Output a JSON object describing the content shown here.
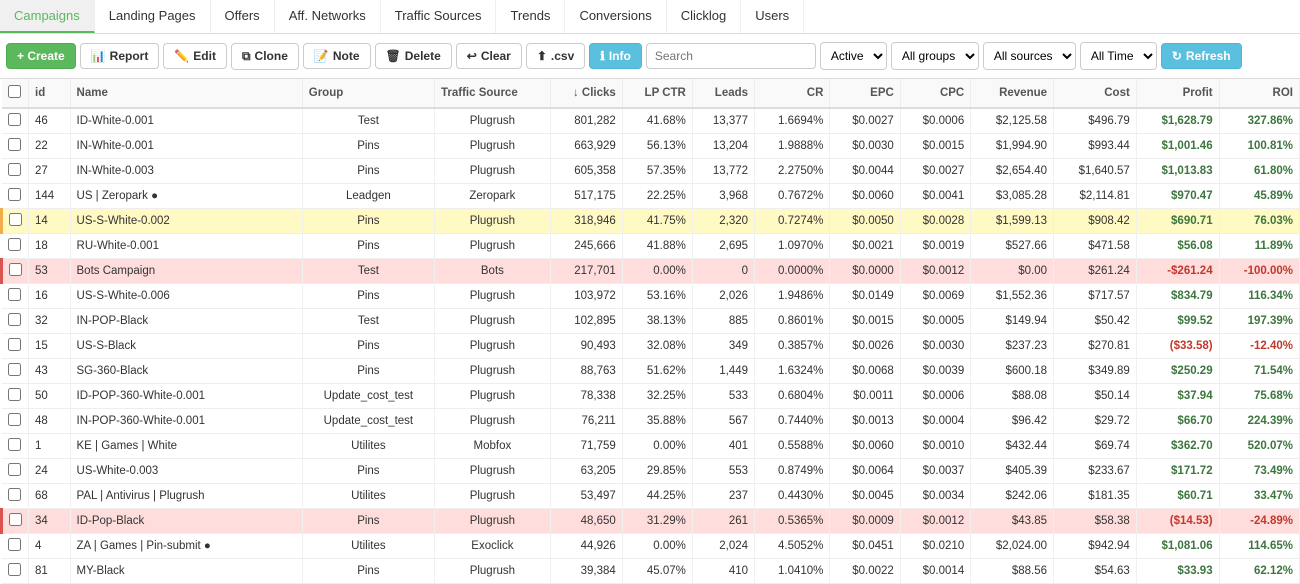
{
  "nav": {
    "items": [
      {
        "label": "Campaigns",
        "active": true
      },
      {
        "label": "Landing Pages",
        "active": false
      },
      {
        "label": "Offers",
        "active": false
      },
      {
        "label": "Aff. Networks",
        "active": false
      },
      {
        "label": "Traffic Sources",
        "active": false
      },
      {
        "label": "Trends",
        "active": false
      },
      {
        "label": "Conversions",
        "active": false
      },
      {
        "label": "Clicklog",
        "active": false
      },
      {
        "label": "Users",
        "active": false
      }
    ]
  },
  "toolbar": {
    "create": "+ Create",
    "report": "Report",
    "edit": "Edit",
    "clone": "Clone",
    "note": "Note",
    "delete": "Delete",
    "clear": "Clear",
    "csv": ".csv",
    "info": "Info",
    "search_placeholder": "Search",
    "active_label": "Active",
    "all_groups": "All groups",
    "all_sources": "All sources",
    "all_time": "All Time",
    "refresh": "Refresh"
  },
  "table": {
    "headers": [
      "",
      "id",
      "Name",
      "Group",
      "Traffic Source",
      "↓ Clicks",
      "LP CTR",
      "Leads",
      "CR",
      "EPC",
      "CPC",
      "Revenue",
      "Cost",
      "Profit",
      "ROI"
    ],
    "rows": [
      {
        "id": 46,
        "name": "ID-White-0.001",
        "group": "Test",
        "traffic_source": "Plugrush",
        "clicks": "801,282",
        "lp_ctr": "41.68%",
        "leads": "13,377",
        "cr": "1.6694%",
        "epc": "$0.0027",
        "cpc": "$0.0006",
        "revenue": "$2,125.58",
        "cost": "$496.79",
        "profit": "$1,628.79",
        "roi": "327.86%",
        "profit_class": "profit-pos",
        "roi_class": "roi-pos",
        "row_class": ""
      },
      {
        "id": 22,
        "name": "IN-White-0.001",
        "group": "Pins",
        "traffic_source": "Plugrush",
        "clicks": "663,929",
        "lp_ctr": "56.13%",
        "leads": "13,204",
        "cr": "1.9888%",
        "epc": "$0.0030",
        "cpc": "$0.0015",
        "revenue": "$1,994.90",
        "cost": "$993.44",
        "profit": "$1,001.46",
        "roi": "100.81%",
        "profit_class": "profit-pos",
        "roi_class": "roi-pos",
        "row_class": ""
      },
      {
        "id": 27,
        "name": "IN-White-0.003",
        "group": "Pins",
        "traffic_source": "Plugrush",
        "clicks": "605,358",
        "lp_ctr": "57.35%",
        "leads": "13,772",
        "cr": "2.2750%",
        "epc": "$0.0044",
        "cpc": "$0.0027",
        "revenue": "$2,654.40",
        "cost": "$1,640.57",
        "profit": "$1,013.83",
        "roi": "61.80%",
        "profit_class": "profit-pos",
        "roi_class": "roi-pos",
        "row_class": ""
      },
      {
        "id": 144,
        "name": "US | Zeropark ●",
        "group": "Leadgen",
        "traffic_source": "Zeropark",
        "clicks": "517,175",
        "lp_ctr": "22.25%",
        "leads": "3,968",
        "cr": "0.7672%",
        "epc": "$0.0060",
        "cpc": "$0.0041",
        "revenue": "$3,085.28",
        "cost": "$2,114.81",
        "profit": "$970.47",
        "roi": "45.89%",
        "profit_class": "profit-pos",
        "roi_class": "roi-pos",
        "row_class": "",
        "dot": true
      },
      {
        "id": 14,
        "name": "US-S-White-0.002",
        "group": "Pins",
        "traffic_source": "Plugrush",
        "clicks": "318,946",
        "lp_ctr": "41.75%",
        "leads": "2,320",
        "cr": "0.7274%",
        "epc": "$0.0050",
        "cpc": "$0.0028",
        "revenue": "$1,599.13",
        "cost": "$908.42",
        "profit": "$690.71",
        "roi": "76.03%",
        "profit_class": "profit-pos",
        "roi_class": "roi-pos",
        "row_class": "row-yellow"
      },
      {
        "id": 18,
        "name": "RU-White-0.001",
        "group": "Pins",
        "traffic_source": "Plugrush",
        "clicks": "245,666",
        "lp_ctr": "41.88%",
        "leads": "2,695",
        "cr": "1.0970%",
        "epc": "$0.0021",
        "cpc": "$0.0019",
        "revenue": "$527.66",
        "cost": "$471.58",
        "profit": "$56.08",
        "roi": "11.89%",
        "profit_class": "profit-pos",
        "roi_class": "roi-pos",
        "row_class": ""
      },
      {
        "id": 53,
        "name": "Bots Campaign",
        "group": "Test",
        "traffic_source": "Bots",
        "clicks": "217,701",
        "lp_ctr": "0.00%",
        "leads": "0",
        "cr": "0.0000%",
        "epc": "$0.0000",
        "cpc": "$0.0012",
        "revenue": "$0.00",
        "cost": "$261.24",
        "profit": "-$261.24",
        "roi": "-100.00%",
        "profit_class": "profit-neg",
        "roi_class": "roi-neg",
        "row_class": "row-red"
      },
      {
        "id": 16,
        "name": "US-S-White-0.006",
        "group": "Pins",
        "traffic_source": "Plugrush",
        "clicks": "103,972",
        "lp_ctr": "53.16%",
        "leads": "2,026",
        "cr": "1.9486%",
        "epc": "$0.0149",
        "cpc": "$0.0069",
        "revenue": "$1,552.36",
        "cost": "$717.57",
        "profit": "$834.79",
        "roi": "116.34%",
        "profit_class": "profit-pos",
        "roi_class": "roi-pos",
        "row_class": ""
      },
      {
        "id": 32,
        "name": "IN-POP-Black",
        "group": "Test",
        "traffic_source": "Plugrush",
        "clicks": "102,895",
        "lp_ctr": "38.13%",
        "leads": "885",
        "cr": "0.8601%",
        "epc": "$0.0015",
        "cpc": "$0.0005",
        "revenue": "$149.94",
        "cost": "$50.42",
        "profit": "$99.52",
        "roi": "197.39%",
        "profit_class": "profit-pos",
        "roi_class": "roi-pos",
        "row_class": ""
      },
      {
        "id": 15,
        "name": "US-S-Black",
        "group": "Pins",
        "traffic_source": "Plugrush",
        "clicks": "90,493",
        "lp_ctr": "32.08%",
        "leads": "349",
        "cr": "0.3857%",
        "epc": "$0.0026",
        "cpc": "$0.0030",
        "revenue": "$237.23",
        "cost": "$270.81",
        "profit": "($33.58)",
        "roi": "-12.40%",
        "profit_class": "profit-neg",
        "roi_class": "roi-neg",
        "row_class": ""
      },
      {
        "id": 43,
        "name": "SG-360-Black",
        "group": "Pins",
        "traffic_source": "Plugrush",
        "clicks": "88,763",
        "lp_ctr": "51.62%",
        "leads": "1,449",
        "cr": "1.6324%",
        "epc": "$0.0068",
        "cpc": "$0.0039",
        "revenue": "$600.18",
        "cost": "$349.89",
        "profit": "$250.29",
        "roi": "71.54%",
        "profit_class": "profit-pos",
        "roi_class": "roi-pos",
        "row_class": ""
      },
      {
        "id": 50,
        "name": "ID-POP-360-White-0.001",
        "group": "Update_cost_test",
        "traffic_source": "Plugrush",
        "clicks": "78,338",
        "lp_ctr": "32.25%",
        "leads": "533",
        "cr": "0.6804%",
        "epc": "$0.0011",
        "cpc": "$0.0006",
        "revenue": "$88.08",
        "cost": "$50.14",
        "profit": "$37.94",
        "roi": "75.68%",
        "profit_class": "profit-pos",
        "roi_class": "roi-pos",
        "row_class": ""
      },
      {
        "id": 48,
        "name": "IN-POP-360-White-0.001",
        "group": "Update_cost_test",
        "traffic_source": "Plugrush",
        "clicks": "76,211",
        "lp_ctr": "35.88%",
        "leads": "567",
        "cr": "0.7440%",
        "epc": "$0.0013",
        "cpc": "$0.0004",
        "revenue": "$96.42",
        "cost": "$29.72",
        "profit": "$66.70",
        "roi": "224.39%",
        "profit_class": "profit-pos",
        "roi_class": "roi-pos",
        "row_class": ""
      },
      {
        "id": 1,
        "name": "KE | Games | White",
        "group": "Utilites",
        "traffic_source": "Mobfox",
        "clicks": "71,759",
        "lp_ctr": "0.00%",
        "leads": "401",
        "cr": "0.5588%",
        "epc": "$0.0060",
        "cpc": "$0.0010",
        "revenue": "$432.44",
        "cost": "$69.74",
        "profit": "$362.70",
        "roi": "520.07%",
        "profit_class": "profit-pos",
        "roi_class": "roi-pos",
        "row_class": ""
      },
      {
        "id": 24,
        "name": "US-White-0.003",
        "group": "Pins",
        "traffic_source": "Plugrush",
        "clicks": "63,205",
        "lp_ctr": "29.85%",
        "leads": "553",
        "cr": "0.8749%",
        "epc": "$0.0064",
        "cpc": "$0.0037",
        "revenue": "$405.39",
        "cost": "$233.67",
        "profit": "$171.72",
        "roi": "73.49%",
        "profit_class": "profit-pos",
        "roi_class": "roi-pos",
        "row_class": ""
      },
      {
        "id": 68,
        "name": "PAL | Antivirus | Plugrush",
        "group": "Utilites",
        "traffic_source": "Plugrush",
        "clicks": "53,497",
        "lp_ctr": "44.25%",
        "leads": "237",
        "cr": "0.4430%",
        "epc": "$0.0045",
        "cpc": "$0.0034",
        "revenue": "$242.06",
        "cost": "$181.35",
        "profit": "$60.71",
        "roi": "33.47%",
        "profit_class": "profit-pos",
        "roi_class": "roi-pos",
        "row_class": ""
      },
      {
        "id": 34,
        "name": "ID-Pop-Black",
        "group": "Pins",
        "traffic_source": "Plugrush",
        "clicks": "48,650",
        "lp_ctr": "31.29%",
        "leads": "261",
        "cr": "0.5365%",
        "epc": "$0.0009",
        "cpc": "$0.0012",
        "revenue": "$43.85",
        "cost": "$58.38",
        "profit": "($14.53)",
        "roi": "-24.89%",
        "profit_class": "profit-neg",
        "roi_class": "roi-neg",
        "row_class": "row-red"
      },
      {
        "id": 4,
        "name": "ZA | Games | Pin-submit ●",
        "group": "Utilites",
        "traffic_source": "Exoclick",
        "clicks": "44,926",
        "lp_ctr": "0.00%",
        "leads": "2,024",
        "cr": "4.5052%",
        "epc": "$0.0451",
        "cpc": "$0.0210",
        "revenue": "$2,024.00",
        "cost": "$942.94",
        "profit": "$1,081.06",
        "roi": "114.65%",
        "profit_class": "profit-pos",
        "roi_class": "roi-pos",
        "row_class": "",
        "dot": true
      },
      {
        "id": 81,
        "name": "MY-Black",
        "group": "Pins",
        "traffic_source": "Plugrush",
        "clicks": "39,384",
        "lp_ctr": "45.07%",
        "leads": "410",
        "cr": "1.0410%",
        "epc": "$0.0022",
        "cpc": "$0.0014",
        "revenue": "$88.56",
        "cost": "$54.63",
        "profit": "$33.93",
        "roi": "62.12%",
        "profit_class": "profit-pos",
        "roi_class": "roi-pos",
        "row_class": ""
      }
    ]
  }
}
